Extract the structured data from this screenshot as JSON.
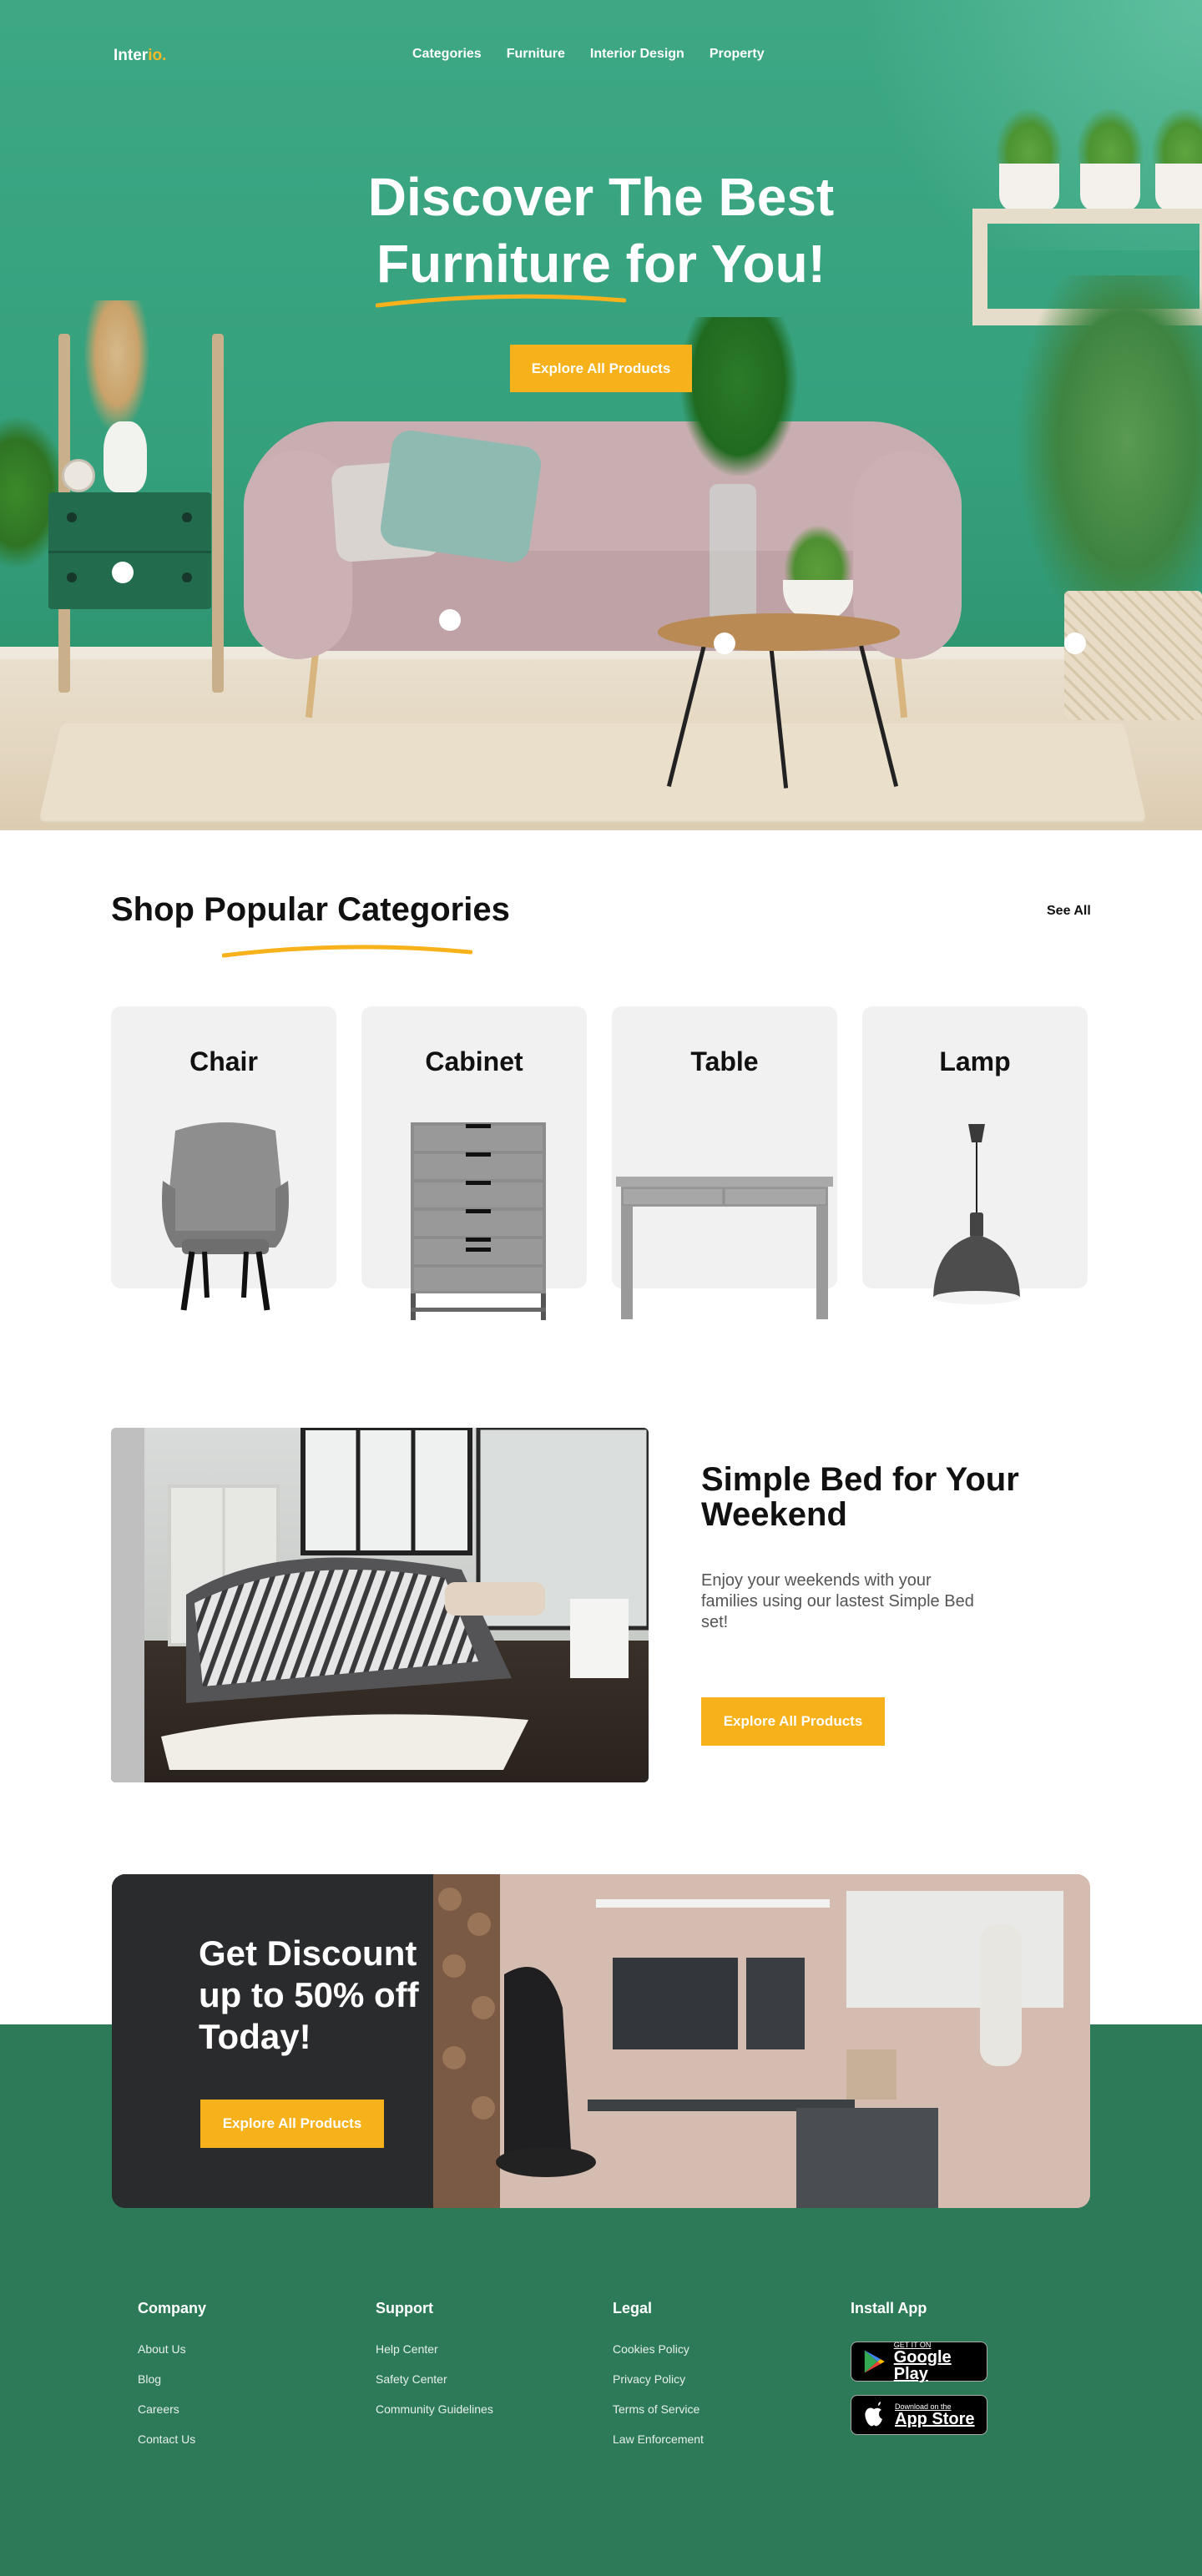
{
  "header": {
    "logo_main": "Inter",
    "logo_accent": "io.",
    "menu": [
      "Categories",
      "Furniture",
      "Interior Design",
      "Property"
    ]
  },
  "hero": {
    "title_line1": "Discover The Best",
    "title_line2": "Furniture for You!",
    "cta": "Explore All Products"
  },
  "categories": {
    "title": "Shop Popular Categories",
    "see_all": "See All",
    "items": [
      {
        "label": "Chair"
      },
      {
        "label": "Cabinet"
      },
      {
        "label": "Table"
      },
      {
        "label": "Lamp"
      }
    ]
  },
  "bed": {
    "title": "Simple Bed for Your Weekend",
    "description": "Enjoy your weekends with your families using our lastest Simple Bed set!",
    "cta": "Explore All Products"
  },
  "promo": {
    "title": "Get Discount up to 50% off Today!",
    "cta": "Explore All Products"
  },
  "footer": {
    "company": {
      "title": "Company",
      "links": [
        "About Us",
        "Blog",
        "Careers",
        "Contact Us"
      ]
    },
    "support": {
      "title": "Support",
      "links": [
        "Help Center",
        "Safety Center",
        "Community Guidelines"
      ]
    },
    "legal": {
      "title": "Legal",
      "links": [
        "Cookies Policy",
        "Privacy Policy",
        "Terms of Service",
        "Law Enforcement"
      ]
    },
    "app": {
      "title": "Install App",
      "google_small": "GET IT ON",
      "google_big": "Google Play",
      "apple_small": "Download on the",
      "apple_big": "App Store"
    }
  },
  "colors": {
    "accent": "#f7b21b",
    "hero_green": "#3ea885",
    "footer_green": "#2d7a58"
  }
}
